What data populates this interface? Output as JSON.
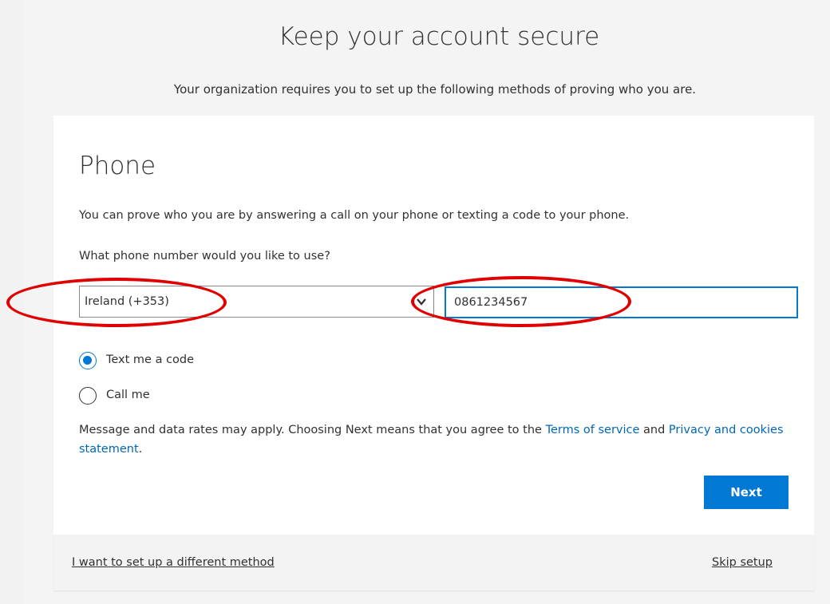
{
  "header": {
    "title": "Keep your account secure",
    "subtitle": "Your organization requires you to set up the following methods of proving who you are."
  },
  "card": {
    "section_title": "Phone",
    "description": "You can prove who you are by answering a call on your phone or texting a code to your phone.",
    "question": "What phone number would you like to use?",
    "country_select": {
      "selected": "Ireland (+353)",
      "icon": "chevron-down-icon"
    },
    "phone_input": {
      "value": "0861234567"
    },
    "options": [
      {
        "label": "Text me a code",
        "checked": true
      },
      {
        "label": "Call me",
        "checked": false
      }
    ],
    "legal": {
      "prefix": "Message and data rates may apply. Choosing Next means that you agree to the ",
      "terms_link": "Terms of service",
      "middle": " and ",
      "privacy_link": "Privacy and cookies statement",
      "suffix": "."
    },
    "next_label": "Next"
  },
  "footer": {
    "different_method": "I want to set up a different method",
    "skip": "Skip setup"
  },
  "colors": {
    "accent": "#0078d4",
    "link": "#0067b8",
    "annotation": "#e00000"
  }
}
